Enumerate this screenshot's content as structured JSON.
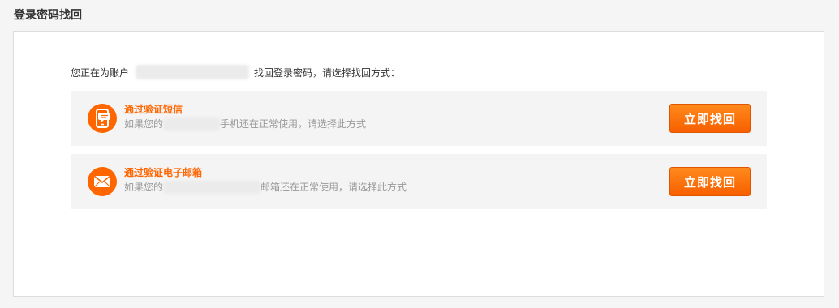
{
  "page": {
    "title": "登录密码找回"
  },
  "intro": {
    "prefix": "您正在为账户",
    "suffix": "找回登录密码，请选择找回方式："
  },
  "options": [
    {
      "icon": "phone-message-icon",
      "title": "通过验证短信",
      "desc_prefix": "如果您的",
      "desc_suffix": "手机还在正常使用，请选择此方式",
      "button_label": "立即找回"
    },
    {
      "icon": "envelope-icon",
      "title": "通过验证电子邮箱",
      "desc_prefix": "如果您的",
      "desc_suffix": "邮箱还在正常使用，请选择此方式",
      "button_label": "立即找回"
    }
  ],
  "colors": {
    "accent": "#ff6600",
    "card_background": "#f4f4f4",
    "page_background": "#f5f5f5"
  }
}
